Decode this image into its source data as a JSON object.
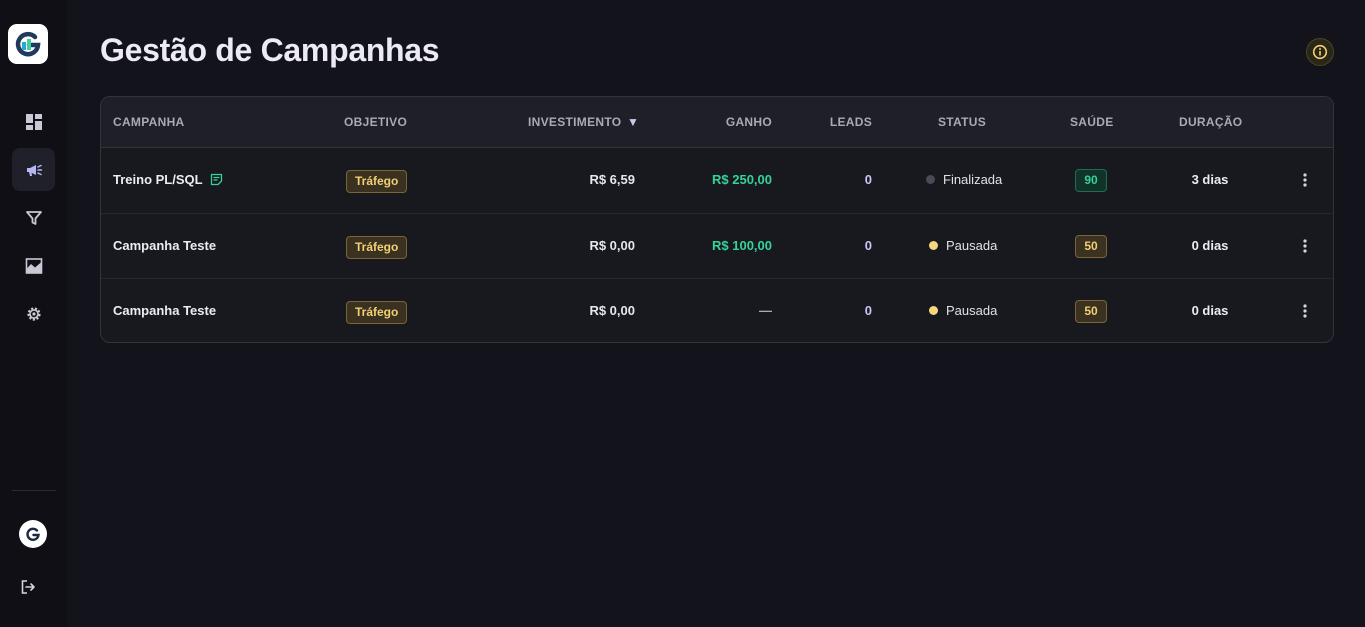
{
  "page": {
    "title": "Gestão de Campanhas"
  },
  "sidebar": {
    "logo_icon": "g-logo-icon",
    "items": [
      {
        "icon": "dashboard-icon",
        "active": false
      },
      {
        "icon": "megaphone-icon",
        "active": true
      },
      {
        "icon": "filter-icon",
        "active": false
      },
      {
        "icon": "chart-area-icon",
        "active": false
      },
      {
        "icon": "gear-icon",
        "active": false
      }
    ],
    "avatar_icon": "g-avatar-icon",
    "logout_icon": "logout-icon"
  },
  "table": {
    "headers": {
      "campanha": "CAMPANHA",
      "objetivo": "OBJETIVO",
      "investimento": "INVESTIMENTO",
      "ganho": "GANHO",
      "leads": "LEADS",
      "status": "STATUS",
      "saude": "SAÚDE",
      "duracao": "DURAÇÃO"
    },
    "sort_indicator": "▼",
    "rows": [
      {
        "campanha": "Treino PL/SQL",
        "has_note_icon": true,
        "objetivo": "Tráfego",
        "investimento": "R$ 6,59",
        "ganho": "R$ 250,00",
        "leads": "0",
        "status": "Finalizada",
        "status_color": "#4b4b57",
        "saude": "90",
        "saude_level": "good",
        "duracao": "3 dias"
      },
      {
        "campanha": "Campanha Teste",
        "has_note_icon": false,
        "objetivo": "Tráfego",
        "investimento": "R$ 0,00",
        "ganho": "R$ 100,00",
        "leads": "0",
        "status": "Pausada",
        "status_color": "#f8d77c",
        "saude": "50",
        "saude_level": "mid",
        "duracao": "0 dias"
      },
      {
        "campanha": "Campanha Teste",
        "has_note_icon": false,
        "objetivo": "Tráfego",
        "investimento": "R$ 0,00",
        "ganho": "—",
        "leads": "0",
        "status": "Pausada",
        "status_color": "#f8d77c",
        "saude": "50",
        "saude_level": "mid",
        "duracao": "0 dias"
      }
    ]
  },
  "colors": {
    "accent_green": "#34d399",
    "accent_yellow": "#f2cf76",
    "background": "#13131b"
  }
}
